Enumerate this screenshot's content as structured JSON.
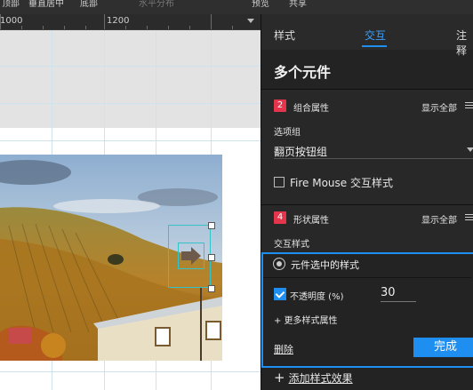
{
  "toolbar": {
    "items": [
      "顶部",
      "垂直居中",
      "底部",
      "水平分布",
      "预览",
      "共享"
    ]
  },
  "ruler": {
    "labels": [
      "1000",
      "1200"
    ]
  },
  "panel": {
    "tabs": [
      "样式",
      "交互",
      "注释"
    ],
    "active_tab": "交互",
    "title": "多个元件",
    "section_group": {
      "badge": "2",
      "title": "组合属性",
      "show_all": "显示全部",
      "option_group_label": "选项组",
      "option_group_value": "翻页按钮组",
      "fire_mouse_label": "Fire Mouse 交互样式"
    },
    "section_shape": {
      "badge": "4",
      "title": "形状属性",
      "show_all": "显示全部",
      "interaction_style_label": "交互样式",
      "selected_style_label": "元件选中的样式",
      "opacity_label": "不透明度 (%)",
      "opacity_value": "30",
      "opacity_checked": true,
      "more_props": "+ 更多样式属性",
      "delete_label": "删除",
      "done_label": "完成"
    },
    "add_effect_label": "添加样式效果"
  },
  "colors": {
    "accent": "#1e8ef0",
    "badge": "#e5354c",
    "selection": "#33c3c8"
  }
}
